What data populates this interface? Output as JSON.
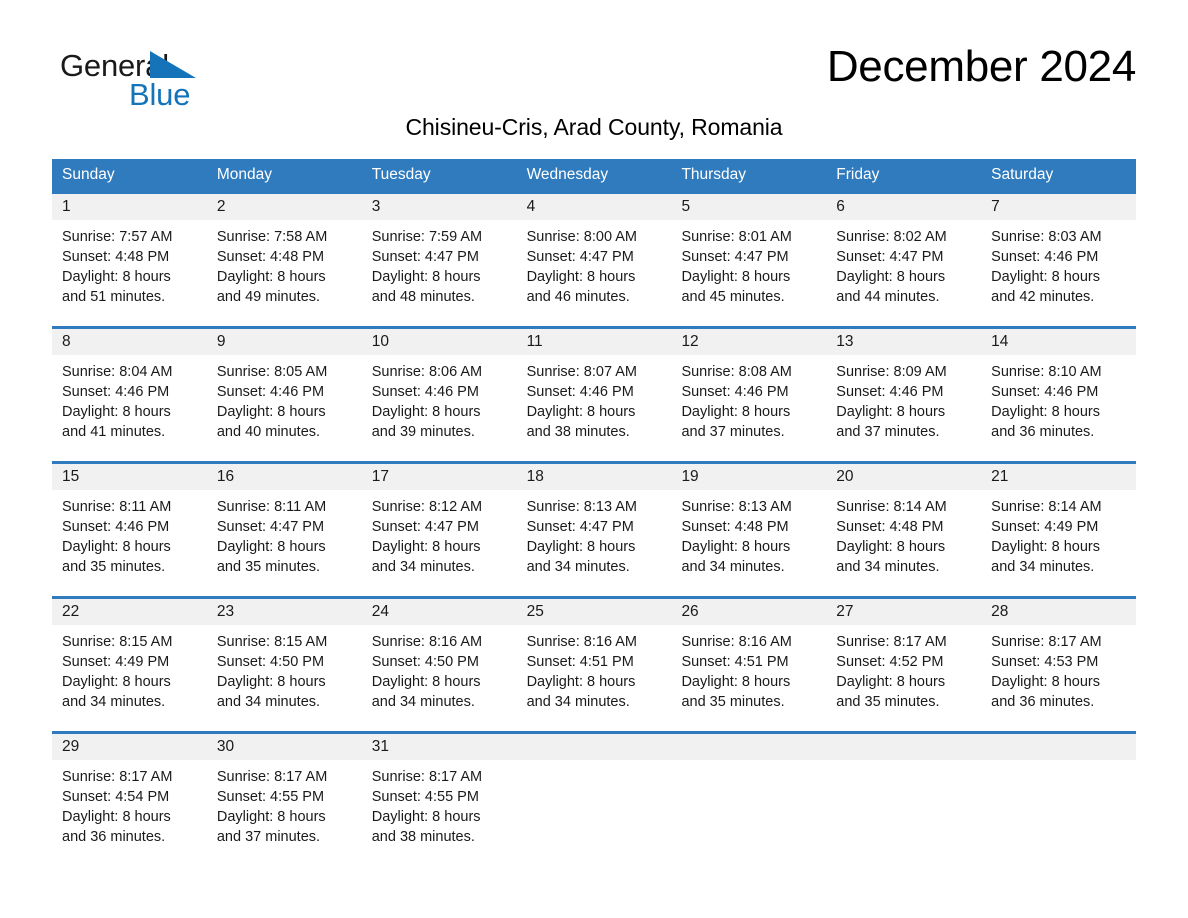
{
  "logo": {
    "word_one": "General",
    "word_two": "Blue",
    "accent_color": "#1573ba"
  },
  "header": {
    "month_title": "December 2024",
    "location_subtitle": "Chisineu-Cris, Arad County, Romania"
  },
  "calendar": {
    "header_color": "#2f7bbd",
    "weekdays": [
      "Sunday",
      "Monday",
      "Tuesday",
      "Wednesday",
      "Thursday",
      "Friday",
      "Saturday"
    ],
    "weeks": [
      [
        {
          "day": "1",
          "sunrise": "Sunrise: 7:57 AM",
          "sunset": "Sunset: 4:48 PM",
          "daylight_line1": "Daylight: 8 hours",
          "daylight_line2": "and 51 minutes."
        },
        {
          "day": "2",
          "sunrise": "Sunrise: 7:58 AM",
          "sunset": "Sunset: 4:48 PM",
          "daylight_line1": "Daylight: 8 hours",
          "daylight_line2": "and 49 minutes."
        },
        {
          "day": "3",
          "sunrise": "Sunrise: 7:59 AM",
          "sunset": "Sunset: 4:47 PM",
          "daylight_line1": "Daylight: 8 hours",
          "daylight_line2": "and 48 minutes."
        },
        {
          "day": "4",
          "sunrise": "Sunrise: 8:00 AM",
          "sunset": "Sunset: 4:47 PM",
          "daylight_line1": "Daylight: 8 hours",
          "daylight_line2": "and 46 minutes."
        },
        {
          "day": "5",
          "sunrise": "Sunrise: 8:01 AM",
          "sunset": "Sunset: 4:47 PM",
          "daylight_line1": "Daylight: 8 hours",
          "daylight_line2": "and 45 minutes."
        },
        {
          "day": "6",
          "sunrise": "Sunrise: 8:02 AM",
          "sunset": "Sunset: 4:47 PM",
          "daylight_line1": "Daylight: 8 hours",
          "daylight_line2": "and 44 minutes."
        },
        {
          "day": "7",
          "sunrise": "Sunrise: 8:03 AM",
          "sunset": "Sunset: 4:46 PM",
          "daylight_line1": "Daylight: 8 hours",
          "daylight_line2": "and 42 minutes."
        }
      ],
      [
        {
          "day": "8",
          "sunrise": "Sunrise: 8:04 AM",
          "sunset": "Sunset: 4:46 PM",
          "daylight_line1": "Daylight: 8 hours",
          "daylight_line2": "and 41 minutes."
        },
        {
          "day": "9",
          "sunrise": "Sunrise: 8:05 AM",
          "sunset": "Sunset: 4:46 PM",
          "daylight_line1": "Daylight: 8 hours",
          "daylight_line2": "and 40 minutes."
        },
        {
          "day": "10",
          "sunrise": "Sunrise: 8:06 AM",
          "sunset": "Sunset: 4:46 PM",
          "daylight_line1": "Daylight: 8 hours",
          "daylight_line2": "and 39 minutes."
        },
        {
          "day": "11",
          "sunrise": "Sunrise: 8:07 AM",
          "sunset": "Sunset: 4:46 PM",
          "daylight_line1": "Daylight: 8 hours",
          "daylight_line2": "and 38 minutes."
        },
        {
          "day": "12",
          "sunrise": "Sunrise: 8:08 AM",
          "sunset": "Sunset: 4:46 PM",
          "daylight_line1": "Daylight: 8 hours",
          "daylight_line2": "and 37 minutes."
        },
        {
          "day": "13",
          "sunrise": "Sunrise: 8:09 AM",
          "sunset": "Sunset: 4:46 PM",
          "daylight_line1": "Daylight: 8 hours",
          "daylight_line2": "and 37 minutes."
        },
        {
          "day": "14",
          "sunrise": "Sunrise: 8:10 AM",
          "sunset": "Sunset: 4:46 PM",
          "daylight_line1": "Daylight: 8 hours",
          "daylight_line2": "and 36 minutes."
        }
      ],
      [
        {
          "day": "15",
          "sunrise": "Sunrise: 8:11 AM",
          "sunset": "Sunset: 4:46 PM",
          "daylight_line1": "Daylight: 8 hours",
          "daylight_line2": "and 35 minutes."
        },
        {
          "day": "16",
          "sunrise": "Sunrise: 8:11 AM",
          "sunset": "Sunset: 4:47 PM",
          "daylight_line1": "Daylight: 8 hours",
          "daylight_line2": "and 35 minutes."
        },
        {
          "day": "17",
          "sunrise": "Sunrise: 8:12 AM",
          "sunset": "Sunset: 4:47 PM",
          "daylight_line1": "Daylight: 8 hours",
          "daylight_line2": "and 34 minutes."
        },
        {
          "day": "18",
          "sunrise": "Sunrise: 8:13 AM",
          "sunset": "Sunset: 4:47 PM",
          "daylight_line1": "Daylight: 8 hours",
          "daylight_line2": "and 34 minutes."
        },
        {
          "day": "19",
          "sunrise": "Sunrise: 8:13 AM",
          "sunset": "Sunset: 4:48 PM",
          "daylight_line1": "Daylight: 8 hours",
          "daylight_line2": "and 34 minutes."
        },
        {
          "day": "20",
          "sunrise": "Sunrise: 8:14 AM",
          "sunset": "Sunset: 4:48 PM",
          "daylight_line1": "Daylight: 8 hours",
          "daylight_line2": "and 34 minutes."
        },
        {
          "day": "21",
          "sunrise": "Sunrise: 8:14 AM",
          "sunset": "Sunset: 4:49 PM",
          "daylight_line1": "Daylight: 8 hours",
          "daylight_line2": "and 34 minutes."
        }
      ],
      [
        {
          "day": "22",
          "sunrise": "Sunrise: 8:15 AM",
          "sunset": "Sunset: 4:49 PM",
          "daylight_line1": "Daylight: 8 hours",
          "daylight_line2": "and 34 minutes."
        },
        {
          "day": "23",
          "sunrise": "Sunrise: 8:15 AM",
          "sunset": "Sunset: 4:50 PM",
          "daylight_line1": "Daylight: 8 hours",
          "daylight_line2": "and 34 minutes."
        },
        {
          "day": "24",
          "sunrise": "Sunrise: 8:16 AM",
          "sunset": "Sunset: 4:50 PM",
          "daylight_line1": "Daylight: 8 hours",
          "daylight_line2": "and 34 minutes."
        },
        {
          "day": "25",
          "sunrise": "Sunrise: 8:16 AM",
          "sunset": "Sunset: 4:51 PM",
          "daylight_line1": "Daylight: 8 hours",
          "daylight_line2": "and 34 minutes."
        },
        {
          "day": "26",
          "sunrise": "Sunrise: 8:16 AM",
          "sunset": "Sunset: 4:51 PM",
          "daylight_line1": "Daylight: 8 hours",
          "daylight_line2": "and 35 minutes."
        },
        {
          "day": "27",
          "sunrise": "Sunrise: 8:17 AM",
          "sunset": "Sunset: 4:52 PM",
          "daylight_line1": "Daylight: 8 hours",
          "daylight_line2": "and 35 minutes."
        },
        {
          "day": "28",
          "sunrise": "Sunrise: 8:17 AM",
          "sunset": "Sunset: 4:53 PM",
          "daylight_line1": "Daylight: 8 hours",
          "daylight_line2": "and 36 minutes."
        }
      ],
      [
        {
          "day": "29",
          "sunrise": "Sunrise: 8:17 AM",
          "sunset": "Sunset: 4:54 PM",
          "daylight_line1": "Daylight: 8 hours",
          "daylight_line2": "and 36 minutes."
        },
        {
          "day": "30",
          "sunrise": "Sunrise: 8:17 AM",
          "sunset": "Sunset: 4:55 PM",
          "daylight_line1": "Daylight: 8 hours",
          "daylight_line2": "and 37 minutes."
        },
        {
          "day": "31",
          "sunrise": "Sunrise: 8:17 AM",
          "sunset": "Sunset: 4:55 PM",
          "daylight_line1": "Daylight: 8 hours",
          "daylight_line2": "and 38 minutes."
        },
        {
          "day": "",
          "sunrise": "",
          "sunset": "",
          "daylight_line1": "",
          "daylight_line2": ""
        },
        {
          "day": "",
          "sunrise": "",
          "sunset": "",
          "daylight_line1": "",
          "daylight_line2": ""
        },
        {
          "day": "",
          "sunrise": "",
          "sunset": "",
          "daylight_line1": "",
          "daylight_line2": ""
        },
        {
          "day": "",
          "sunrise": "",
          "sunset": "",
          "daylight_line1": "",
          "daylight_line2": ""
        }
      ]
    ]
  }
}
